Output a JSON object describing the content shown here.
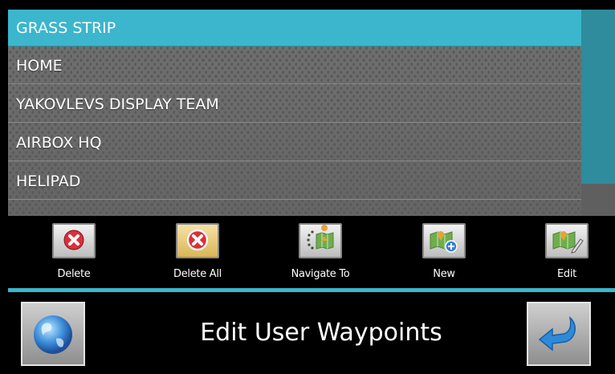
{
  "waypoints": [
    {
      "label": "GRASS STRIP",
      "selected": true
    },
    {
      "label": "HOME",
      "selected": false
    },
    {
      "label": "YAKOVLEVS DISPLAY TEAM",
      "selected": false
    },
    {
      "label": "AIRBOX HQ",
      "selected": false
    },
    {
      "label": "HELIPAD",
      "selected": false
    }
  ],
  "toolbar": {
    "delete_label": "Delete",
    "delete_all_label": "Delete All",
    "navigate_label": "Navigate To",
    "new_label": "New",
    "edit_label": "Edit"
  },
  "footer": {
    "title": "Edit User Waypoints",
    "left_icon": "globe-icon",
    "right_icon": "back-arrow-icon"
  },
  "colors": {
    "accent": "#3bb6cc",
    "scroll_thumb": "#2e8c9d",
    "delete_red": "#d9303a"
  }
}
